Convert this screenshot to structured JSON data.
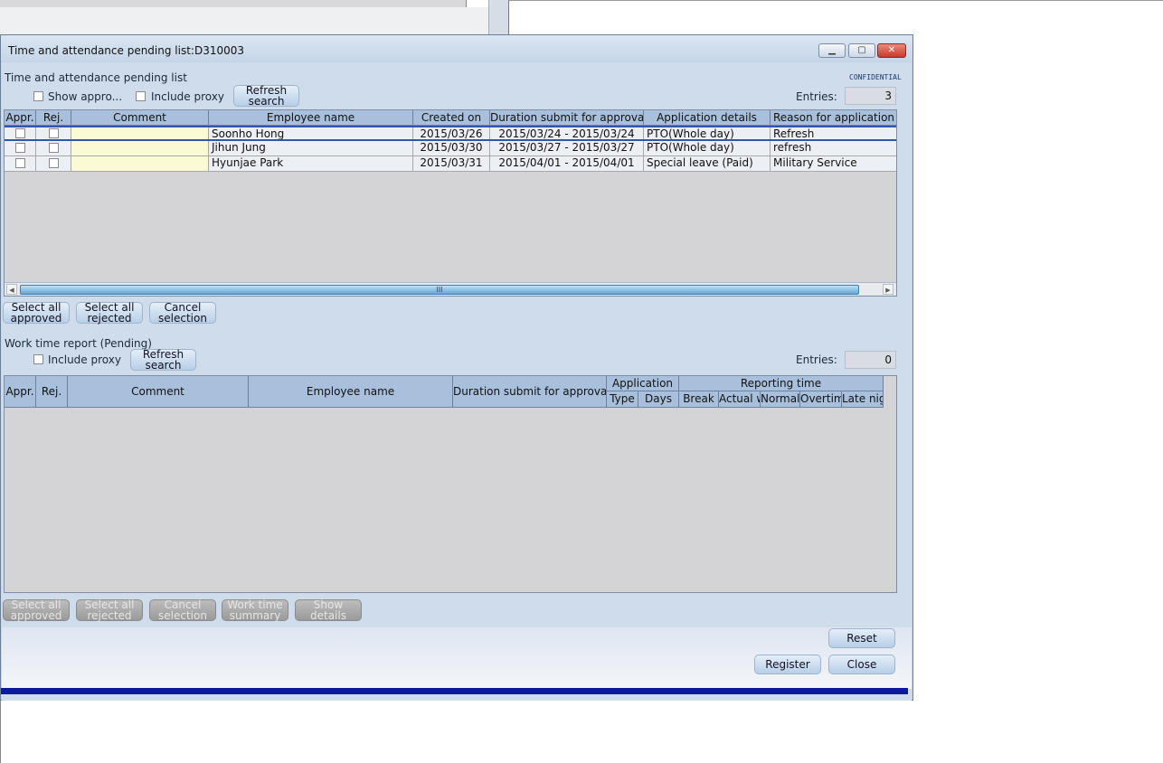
{
  "dialog": {
    "title": "Time and attendance pending list:D310003"
  },
  "section1": {
    "title": "Time and attendance pending list",
    "confidential": "CONFIDENTIAL",
    "show_approved_label": "Show appro...",
    "include_proxy_label": "Include proxy",
    "refresh_label_1": "Refresh",
    "refresh_label_2": "search",
    "entries_label": "Entries:",
    "entries_value": "3",
    "columns": [
      "Appr.",
      "Rej.",
      "Comment",
      "Employee name",
      "Created on",
      "Duration submit for approval",
      "Application details",
      "Reason for application"
    ],
    "rows": [
      {
        "employee": "Soonho Hong",
        "created": "2015/03/26",
        "duration": "2015/03/24 - 2015/03/24",
        "details": "PTO(Whole day)",
        "reason": "Refresh"
      },
      {
        "employee": "Jihun Jung",
        "created": "2015/03/30",
        "duration": "2015/03/27 - 2015/03/27",
        "details": "PTO(Whole day)",
        "reason": "refresh"
      },
      {
        "employee": "Hyunjae Park",
        "created": "2015/03/31",
        "duration": "2015/04/01  -  2015/04/01",
        "details": "Special leave (Paid)",
        "reason": "Military Service"
      }
    ],
    "scroll_thumb": "III",
    "buttons": {
      "select_all_approved_1": "Select all",
      "select_all_approved_2": "approved",
      "select_all_rejected_1": "Select all",
      "select_all_rejected_2": "rejected",
      "cancel_selection_1": "Cancel",
      "cancel_selection_2": "selection"
    }
  },
  "section2": {
    "title": "Work time report (Pending)",
    "include_proxy_label": "Include proxy",
    "refresh_label_1": "Refresh",
    "refresh_label_2": "search",
    "entries_label": "Entries:",
    "entries_value": "0",
    "columns": {
      "appr": "Appr.",
      "rej": "Rej.",
      "comment": "Comment",
      "employee": "Employee name",
      "duration": "Duration submit for approval",
      "application": "Application",
      "type": "Type",
      "days": "Days",
      "reporting_time": "Reporting time",
      "break": "Break",
      "actual": "Actual w",
      "normal": "Normal",
      "overtime": "Overtim",
      "late_night": "Late nig"
    },
    "buttons": {
      "select_all_approved_1": "Select all",
      "select_all_approved_2": "approved",
      "select_all_rejected_1": "Select all",
      "select_all_rejected_2": "rejected",
      "cancel_selection_1": "Cancel",
      "cancel_selection_2": "selection",
      "work_time_summary_1": "Work time",
      "work_time_summary_2": "summary",
      "show_details": "Show details"
    }
  },
  "footer": {
    "reset": "Reset",
    "register": "Register",
    "close": "Close"
  }
}
